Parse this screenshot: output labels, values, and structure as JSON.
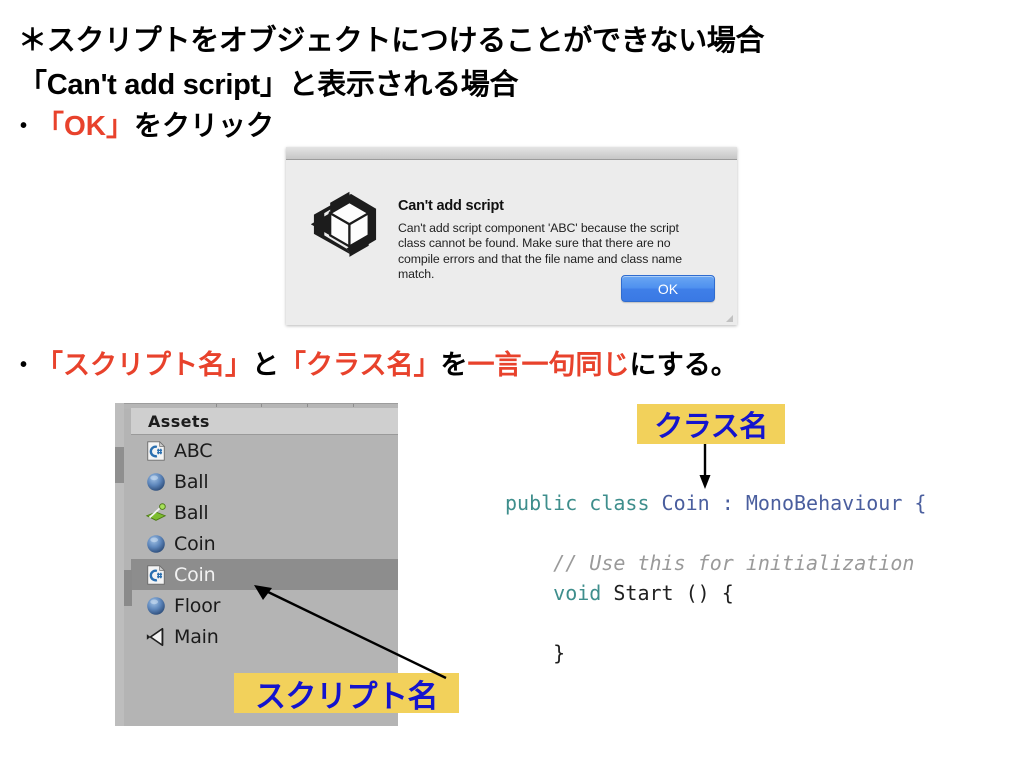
{
  "slide": {
    "headline_line1": "＊スクリプトをオブジェクトにつけることができない場合",
    "headline_line2": "「Can't add script」と表示される場合",
    "bullet1": {
      "marker": "•",
      "segment_red": "「OK」",
      "segment_black": "をクリック"
    },
    "bullet2": {
      "marker": "•",
      "seg1_red": "「スクリプト名」",
      "seg2_black": "と",
      "seg3_red": "「クラス名」",
      "seg4_black": "を",
      "seg5_red": "一言一句同じ",
      "seg6_black": "にする。"
    }
  },
  "dialog": {
    "icon": "unity-logo-icon",
    "heading": "Can't add script",
    "message": "Can't add script component 'ABC' because the script class cannot be found. Make sure that there are no compile errors and that the file name and class name match.",
    "ok_label": "OK"
  },
  "assets_panel": {
    "header": "Assets",
    "rows": [
      {
        "label": "ABC",
        "icon": "csharp-script-icon",
        "selected": false
      },
      {
        "label": "Ball",
        "icon": "prefab-sphere-icon",
        "selected": false
      },
      {
        "label": "Ball",
        "icon": "material-icon",
        "selected": false
      },
      {
        "label": "Coin",
        "icon": "prefab-sphere-icon",
        "selected": false
      },
      {
        "label": "Coin",
        "icon": "csharp-script-icon",
        "selected": true
      },
      {
        "label": "Floor",
        "icon": "prefab-sphere-icon",
        "selected": false
      },
      {
        "label": "Main",
        "icon": "camera-icon",
        "selected": false
      }
    ]
  },
  "annotations": {
    "class_name_label": "クラス名",
    "script_name_label": "スクリプト名"
  },
  "code": {
    "lines": [
      [
        {
          "t": "public class ",
          "c": "kw"
        },
        {
          "t": "Coin : MonoBehaviour ",
          "c": "typ"
        },
        {
          "t": "{",
          "c": "typ"
        }
      ],
      [],
      [
        {
          "t": "    // Use this for initialization",
          "c": "cmt"
        }
      ],
      [
        {
          "t": "    void ",
          "c": "kw"
        },
        {
          "t": "Start () {",
          "c": "plain"
        }
      ],
      [],
      [
        {
          "t": "    }",
          "c": "plain"
        }
      ]
    ]
  },
  "colors": {
    "accent_red": "#E8422C",
    "highlight_yellow": "#F2D15B",
    "highlight_text_blue": "#1414CD",
    "code_keyword": "#3E8E8C",
    "code_type": "#4A5E9E",
    "code_comment": "#9A9A9A",
    "button_blue": "#4E90EF"
  }
}
